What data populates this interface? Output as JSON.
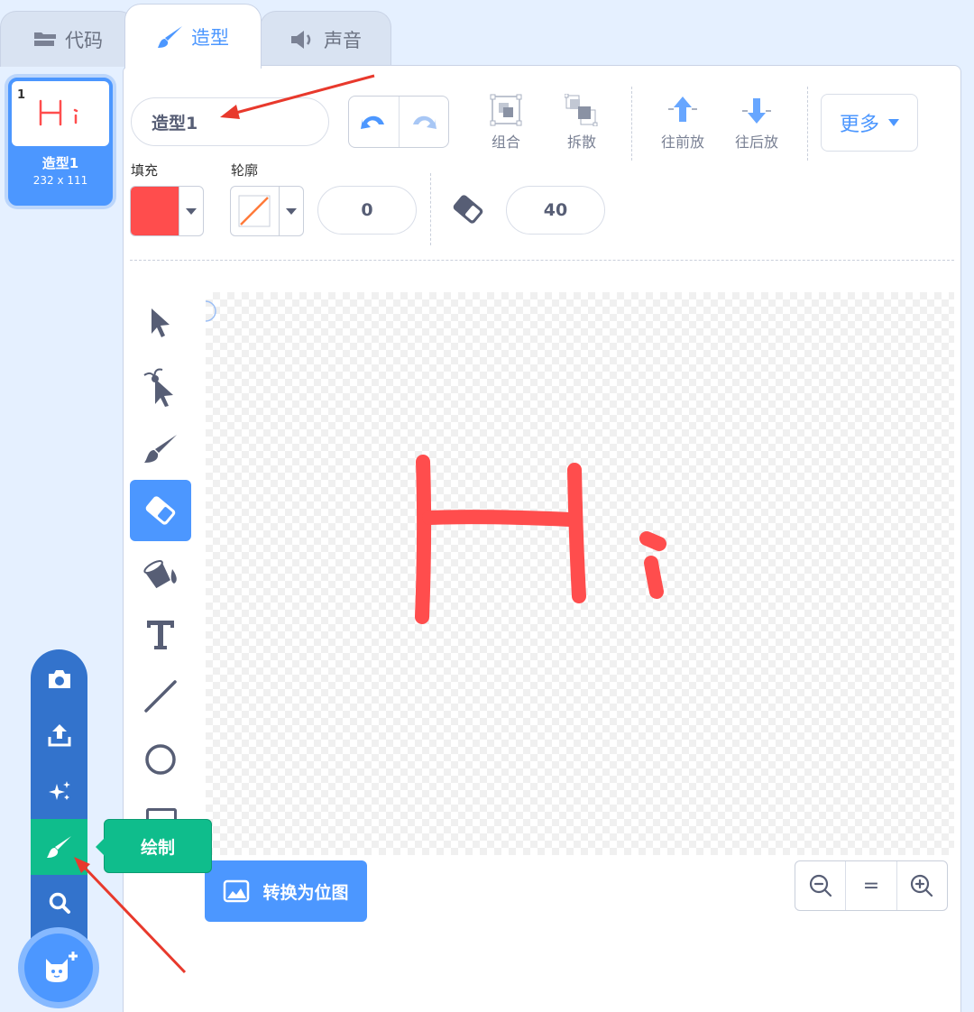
{
  "tabs": [
    {
      "label": "代码",
      "icon": "code-blocks-icon"
    },
    {
      "label": "造型",
      "icon": "paintbrush-icon"
    },
    {
      "label": "声音",
      "icon": "speaker-icon"
    }
  ],
  "costume": {
    "number": "1",
    "name": "造型1",
    "size": "232 x 111",
    "thumb_text": "Hi"
  },
  "toolbar": {
    "costume_name_value": "造型1",
    "group_label": "组合",
    "ungroup_label": "拆散",
    "forward_label": "往前放",
    "backward_label": "往后放",
    "more_label": "更多"
  },
  "fill": {
    "label": "填充",
    "color": "#ff4d4d"
  },
  "outline": {
    "label": "轮廓",
    "width": "0"
  },
  "eraser_size": "40",
  "tools": [
    "select-arrow-icon",
    "reshape-icon",
    "brush-icon",
    "eraser-icon",
    "fill-bucket-icon",
    "text-icon",
    "line-icon",
    "circle-icon",
    "rectangle-icon"
  ],
  "active_tool": "eraser-icon",
  "canvas": {
    "drawing_text": "Hi",
    "stroke_color": "#ff4d4d"
  },
  "convert_button": "转换为位图",
  "zoom": {
    "out": "−",
    "reset": "=",
    "in": "+"
  },
  "add_menu": {
    "tooltip": "绘制"
  },
  "colors": {
    "accent": "#4c97ff",
    "green": "#0fbd8c",
    "dark_blue": "#3373cc",
    "annotation_arrow": "#e8392c"
  }
}
